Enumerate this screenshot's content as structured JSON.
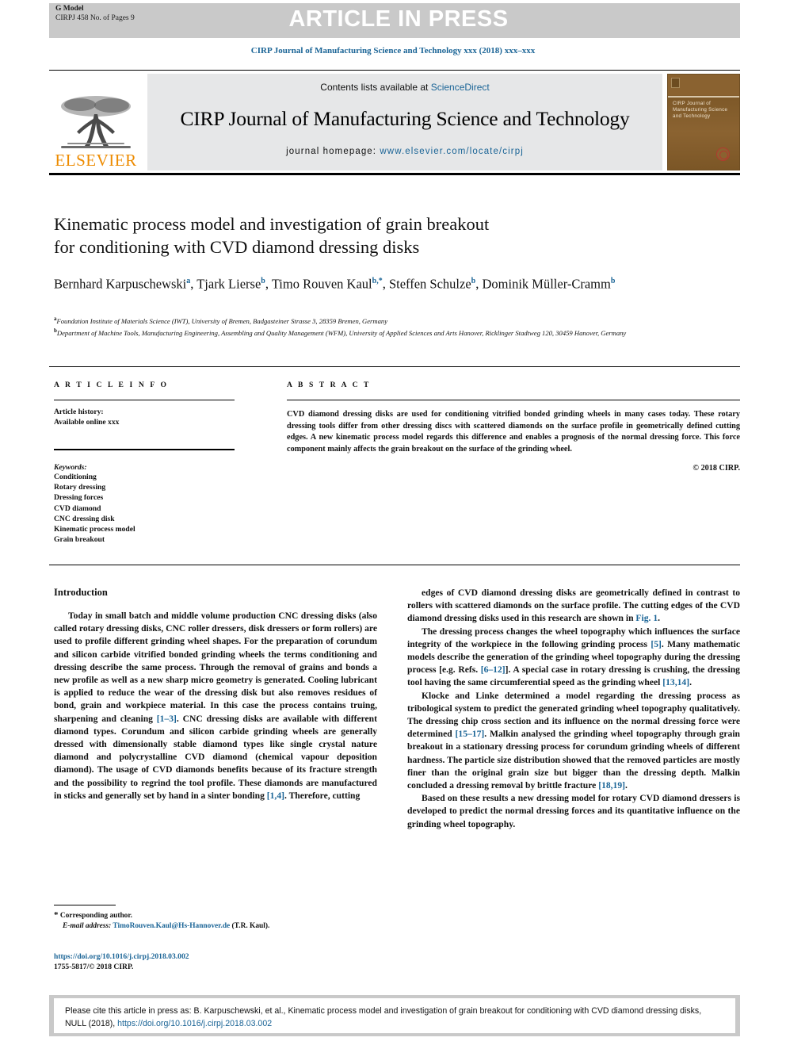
{
  "header": {
    "g_model_line1": "G Model",
    "g_model_line2": "CIRPJ 458 No. of Pages 9",
    "press_banner": "ARTICLE IN PRESS",
    "running_head": "CIRP Journal of Manufacturing Science and Technology xxx (2018) xxx–xxx"
  },
  "masthead": {
    "contents_prefix": "Contents lists available at ",
    "contents_link": "ScienceDirect",
    "journal_name": "CIRP Journal of Manufacturing Science and Technology",
    "homepage_label": "journal homepage: ",
    "homepage_url": "www.elsevier.com/locate/cirpj",
    "publisher": "ELSEVIER",
    "cover_title": "CIRP Journal of Manufacturing Science and Technology",
    "accent_color": "#1a6496",
    "elsevier_orange": "#ED8B00",
    "band_gray": "#c9c9c9"
  },
  "article": {
    "title_line1": "Kinematic process model and investigation of grain breakout",
    "title_line2": "for conditioning with CVD diamond dressing disks",
    "authors": [
      {
        "name": "Bernhard Karpuschewski",
        "sup": "a",
        "sep": ", "
      },
      {
        "name": "Tjark Lierse",
        "sup": "b",
        "sep": ", "
      },
      {
        "name": "Timo Rouven Kaul",
        "sup": "b,*",
        "sep": ", "
      },
      {
        "name": "Steffen Schulze",
        "sup": "b",
        "sep": ", "
      },
      {
        "name": "Dominik Müller-Cramm",
        "sup": "b",
        "sep": ""
      }
    ],
    "affiliations": [
      {
        "marker": "a",
        "text": "Foundation Institute of Materials Science (IWT), University of Bremen, Badgasteiner Strasse 3, 28359 Bremen, Germany"
      },
      {
        "marker": "b",
        "text": "Department of Machine Tools, Manufacturing Engineering, Assembling and Quality Management (WFM), University of Applied Sciences and Arts Hanover, Ricklinger Stadtweg 120, 30459 Hanover, Germany"
      }
    ]
  },
  "article_info": {
    "heading": "A R T I C L E  I N F O",
    "history_label": "Article history:",
    "history_value": "Available online xxx",
    "keywords_label": "Keywords:",
    "keywords": [
      "Conditioning",
      "Rotary dressing",
      "Dressing forces",
      "CVD diamond",
      "CNC dressing disk",
      "Kinematic process model",
      "Grain breakout"
    ]
  },
  "abstract": {
    "heading": "A B S T R A C T",
    "body": "CVD diamond dressing disks are used for conditioning vitrified bonded grinding wheels in many cases today. These rotary dressing tools differ from other dressing discs with scattered diamonds on the surface profile in geometrically defined cutting edges. A new kinematic process model regards this difference and enables a prognosis of the normal dressing force. This force component mainly affects the grain breakout on the surface of the grinding wheel.",
    "copyright": "© 2018 CIRP."
  },
  "introduction": {
    "heading": "Introduction",
    "left_paragraphs": [
      "Today in small batch and middle volume production CNC dressing disks (also called rotary dressing disks, CNC roller dressers, disk dressers or form rollers) are used to profile different grinding wheel shapes. For the preparation of corundum and silicon carbide vitrified bonded grinding wheels the terms conditioning and dressing describe the same process. Through the removal of grains and bonds a new profile as well as a new sharp micro geometry is generated. Cooling lubricant is applied to reduce the wear of the dressing disk but also removes residues of bond, grain and workpiece material. In this case the process contains truing, sharpening and cleaning [1–3]. CNC dressing disks are available with different diamond types. Corundum and silicon carbide grinding wheels are generally dressed with dimensionally stable diamond types like single crystal nature diamond and polycrystalline CVD diamond (chemical vapour deposition diamond). The usage of CVD diamonds benefits because of its fracture strength and the possibility to regrind the tool profile. These diamonds are manufactured in sticks and generally set by hand in a sinter bonding [1,4]. Therefore, cutting"
    ],
    "right_paragraphs": [
      "edges of CVD diamond dressing disks are geometrically defined in contrast to rollers with scattered diamonds on the surface profile. The cutting edges of the CVD diamond dressing disks used in this research are shown in Fig. 1.",
      "The dressing process changes the wheel topography which influences the surface integrity of the workpiece in the following grinding process [5]. Many mathematic models describe the generation of the grinding wheel topography during the dressing process [e.g. Refs. [6–12]]. A special case in rotary dressing is crushing, the dressing tool having the same circumferential speed as the grinding wheel [13,14].",
      "Klocke and Linke determined a model regarding the dressing process as tribological system to predict the generated grinding wheel topography qualitatively. The dressing chip cross section and its influence on the normal dressing force were determined [15–17]. Malkin analysed the grinding wheel topography through grain breakout in a stationary dressing process for corundum grinding wheels of different hardness. The particle size distribution showed that the removed particles are mostly finer than the original grain size but bigger than the dressing depth. Malkin concluded a dressing removal by brittle fracture [18,19].",
      "Based on these results a new dressing model for rotary CVD diamond dressers is developed to predict the normal dressing forces and its quantitative influence on the grinding wheel topography."
    ]
  },
  "footnote": {
    "star": "*",
    "corresponding": "Corresponding author.",
    "email_label": "E-mail address:",
    "email": "TimoRouven.Kaul@Hs-Hannover.de",
    "email_suffix": "(T.R. Kaul)."
  },
  "doi_footer": {
    "doi_url": "https://doi.org/10.1016/j.cirpj.2018.03.002",
    "issn_line": "1755-5817/© 2018 CIRP."
  },
  "cite_footer": {
    "text_before": "Please cite this article in press as: B. Karpuschewski, et al., Kinematic process model and investigation of grain breakout for conditioning with CVD diamond dressing disks, NULL (2018), ",
    "doi_link": "https://doi.org/10.1016/j.cirpj.2018.03.002"
  }
}
